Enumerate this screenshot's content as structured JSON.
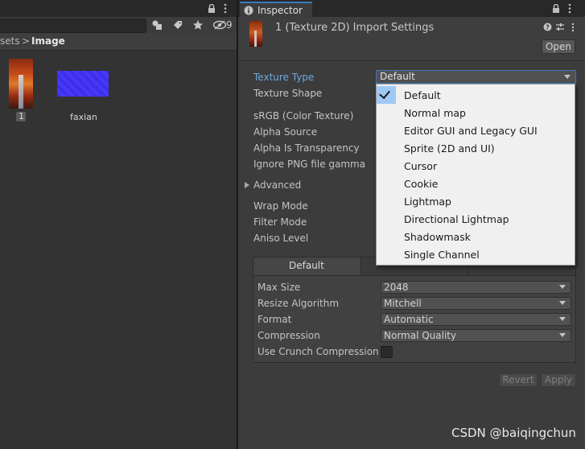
{
  "project": {
    "hidden_count": "9",
    "breadcrumb": {
      "parent": "sets",
      "separator": ">",
      "current": "Image"
    },
    "assets": [
      {
        "name": "1",
        "kind": "texture",
        "thumb": "red-forest-road"
      },
      {
        "name": "faxian",
        "kind": "normal-map",
        "thumb": "purple-normal-map"
      }
    ]
  },
  "inspector": {
    "tab_label": "Inspector",
    "title": "1 (Texture 2D) Import Settings",
    "open_button": "Open",
    "fields": {
      "texture_type": {
        "label": "Texture Type",
        "value": "Default"
      },
      "texture_shape": "Texture Shape",
      "srgb": "sRGB (Color Texture)",
      "alpha_source": "Alpha Source",
      "alpha_transparency": "Alpha Is Transparency",
      "ignore_png": "Ignore PNG file gamma",
      "advanced": "Advanced",
      "wrap_mode": "Wrap Mode",
      "filter_mode": "Filter Mode",
      "aniso_level": "Aniso Level"
    },
    "platform": {
      "tab_default": "Default",
      "max_size": {
        "label": "Max Size",
        "value": "2048"
      },
      "resize_algorithm": {
        "label": "Resize Algorithm",
        "value": "Mitchell"
      },
      "format": {
        "label": "Format",
        "value": "Automatic"
      },
      "compression": {
        "label": "Compression",
        "value": "Normal Quality"
      },
      "crunch": {
        "label": "Use Crunch Compression",
        "checked": false
      }
    },
    "revert_button": "Revert",
    "apply_button": "Apply"
  },
  "dropdown": {
    "selected": "Default",
    "options": [
      "Default",
      "Normal map",
      "Editor GUI and Legacy GUI",
      "Sprite (2D and UI)",
      "Cursor",
      "Cookie",
      "Lightmap",
      "Directional Lightmap",
      "Shadowmask",
      "Single Channel"
    ]
  },
  "watermark": "CSDN @baiqingchun",
  "colors": {
    "accent": "#3a79bb",
    "selection": "#9ec9f5",
    "label_active": "#6fa8dc"
  }
}
